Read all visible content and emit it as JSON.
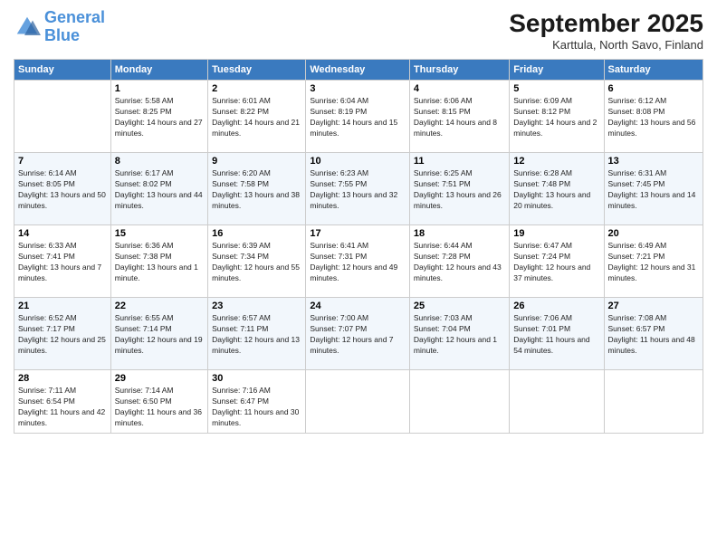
{
  "header": {
    "logo_line1": "General",
    "logo_line2": "Blue",
    "month": "September 2025",
    "location": "Karttula, North Savo, Finland"
  },
  "days_of_week": [
    "Sunday",
    "Monday",
    "Tuesday",
    "Wednesday",
    "Thursday",
    "Friday",
    "Saturday"
  ],
  "weeks": [
    [
      {
        "day": "",
        "sunrise": "",
        "sunset": "",
        "daylight": ""
      },
      {
        "day": "1",
        "sunrise": "Sunrise: 5:58 AM",
        "sunset": "Sunset: 8:25 PM",
        "daylight": "Daylight: 14 hours and 27 minutes."
      },
      {
        "day": "2",
        "sunrise": "Sunrise: 6:01 AM",
        "sunset": "Sunset: 8:22 PM",
        "daylight": "Daylight: 14 hours and 21 minutes."
      },
      {
        "day": "3",
        "sunrise": "Sunrise: 6:04 AM",
        "sunset": "Sunset: 8:19 PM",
        "daylight": "Daylight: 14 hours and 15 minutes."
      },
      {
        "day": "4",
        "sunrise": "Sunrise: 6:06 AM",
        "sunset": "Sunset: 8:15 PM",
        "daylight": "Daylight: 14 hours and 8 minutes."
      },
      {
        "day": "5",
        "sunrise": "Sunrise: 6:09 AM",
        "sunset": "Sunset: 8:12 PM",
        "daylight": "Daylight: 14 hours and 2 minutes."
      },
      {
        "day": "6",
        "sunrise": "Sunrise: 6:12 AM",
        "sunset": "Sunset: 8:08 PM",
        "daylight": "Daylight: 13 hours and 56 minutes."
      }
    ],
    [
      {
        "day": "7",
        "sunrise": "Sunrise: 6:14 AM",
        "sunset": "Sunset: 8:05 PM",
        "daylight": "Daylight: 13 hours and 50 minutes."
      },
      {
        "day": "8",
        "sunrise": "Sunrise: 6:17 AM",
        "sunset": "Sunset: 8:02 PM",
        "daylight": "Daylight: 13 hours and 44 minutes."
      },
      {
        "day": "9",
        "sunrise": "Sunrise: 6:20 AM",
        "sunset": "Sunset: 7:58 PM",
        "daylight": "Daylight: 13 hours and 38 minutes."
      },
      {
        "day": "10",
        "sunrise": "Sunrise: 6:23 AM",
        "sunset": "Sunset: 7:55 PM",
        "daylight": "Daylight: 13 hours and 32 minutes."
      },
      {
        "day": "11",
        "sunrise": "Sunrise: 6:25 AM",
        "sunset": "Sunset: 7:51 PM",
        "daylight": "Daylight: 13 hours and 26 minutes."
      },
      {
        "day": "12",
        "sunrise": "Sunrise: 6:28 AM",
        "sunset": "Sunset: 7:48 PM",
        "daylight": "Daylight: 13 hours and 20 minutes."
      },
      {
        "day": "13",
        "sunrise": "Sunrise: 6:31 AM",
        "sunset": "Sunset: 7:45 PM",
        "daylight": "Daylight: 13 hours and 14 minutes."
      }
    ],
    [
      {
        "day": "14",
        "sunrise": "Sunrise: 6:33 AM",
        "sunset": "Sunset: 7:41 PM",
        "daylight": "Daylight: 13 hours and 7 minutes."
      },
      {
        "day": "15",
        "sunrise": "Sunrise: 6:36 AM",
        "sunset": "Sunset: 7:38 PM",
        "daylight": "Daylight: 13 hours and 1 minute."
      },
      {
        "day": "16",
        "sunrise": "Sunrise: 6:39 AM",
        "sunset": "Sunset: 7:34 PM",
        "daylight": "Daylight: 12 hours and 55 minutes."
      },
      {
        "day": "17",
        "sunrise": "Sunrise: 6:41 AM",
        "sunset": "Sunset: 7:31 PM",
        "daylight": "Daylight: 12 hours and 49 minutes."
      },
      {
        "day": "18",
        "sunrise": "Sunrise: 6:44 AM",
        "sunset": "Sunset: 7:28 PM",
        "daylight": "Daylight: 12 hours and 43 minutes."
      },
      {
        "day": "19",
        "sunrise": "Sunrise: 6:47 AM",
        "sunset": "Sunset: 7:24 PM",
        "daylight": "Daylight: 12 hours and 37 minutes."
      },
      {
        "day": "20",
        "sunrise": "Sunrise: 6:49 AM",
        "sunset": "Sunset: 7:21 PM",
        "daylight": "Daylight: 12 hours and 31 minutes."
      }
    ],
    [
      {
        "day": "21",
        "sunrise": "Sunrise: 6:52 AM",
        "sunset": "Sunset: 7:17 PM",
        "daylight": "Daylight: 12 hours and 25 minutes."
      },
      {
        "day": "22",
        "sunrise": "Sunrise: 6:55 AM",
        "sunset": "Sunset: 7:14 PM",
        "daylight": "Daylight: 12 hours and 19 minutes."
      },
      {
        "day": "23",
        "sunrise": "Sunrise: 6:57 AM",
        "sunset": "Sunset: 7:11 PM",
        "daylight": "Daylight: 12 hours and 13 minutes."
      },
      {
        "day": "24",
        "sunrise": "Sunrise: 7:00 AM",
        "sunset": "Sunset: 7:07 PM",
        "daylight": "Daylight: 12 hours and 7 minutes."
      },
      {
        "day": "25",
        "sunrise": "Sunrise: 7:03 AM",
        "sunset": "Sunset: 7:04 PM",
        "daylight": "Daylight: 12 hours and 1 minute."
      },
      {
        "day": "26",
        "sunrise": "Sunrise: 7:06 AM",
        "sunset": "Sunset: 7:01 PM",
        "daylight": "Daylight: 11 hours and 54 minutes."
      },
      {
        "day": "27",
        "sunrise": "Sunrise: 7:08 AM",
        "sunset": "Sunset: 6:57 PM",
        "daylight": "Daylight: 11 hours and 48 minutes."
      }
    ],
    [
      {
        "day": "28",
        "sunrise": "Sunrise: 7:11 AM",
        "sunset": "Sunset: 6:54 PM",
        "daylight": "Daylight: 11 hours and 42 minutes."
      },
      {
        "day": "29",
        "sunrise": "Sunrise: 7:14 AM",
        "sunset": "Sunset: 6:50 PM",
        "daylight": "Daylight: 11 hours and 36 minutes."
      },
      {
        "day": "30",
        "sunrise": "Sunrise: 7:16 AM",
        "sunset": "Sunset: 6:47 PM",
        "daylight": "Daylight: 11 hours and 30 minutes."
      },
      {
        "day": "",
        "sunrise": "",
        "sunset": "",
        "daylight": ""
      },
      {
        "day": "",
        "sunrise": "",
        "sunset": "",
        "daylight": ""
      },
      {
        "day": "",
        "sunrise": "",
        "sunset": "",
        "daylight": ""
      },
      {
        "day": "",
        "sunrise": "",
        "sunset": "",
        "daylight": ""
      }
    ]
  ]
}
